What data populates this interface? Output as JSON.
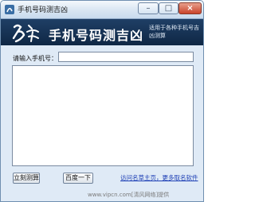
{
  "window": {
    "title": "手机号码测吉凶",
    "controls": {
      "minimize": "–",
      "maximize": "□",
      "close": "×"
    }
  },
  "banner": {
    "title": "手机号码测吉凶",
    "subtitle": "适用于各种手机号吉凶测算",
    "logo_icon": "name-brush-logo-icon"
  },
  "form": {
    "phone_label": "请输入手机号：",
    "phone_value": ""
  },
  "result": {
    "text": ""
  },
  "buttons": {
    "calculate": "立刻测算",
    "baidu": "百度一下"
  },
  "link": "访问名草主页，更多取名软件",
  "watermark": "www.vipcn.com[清风网络]提供",
  "colors": {
    "banner_bg": "#1a365c",
    "link": "#1d3fb5",
    "window_bg": "#dfeaf6"
  }
}
